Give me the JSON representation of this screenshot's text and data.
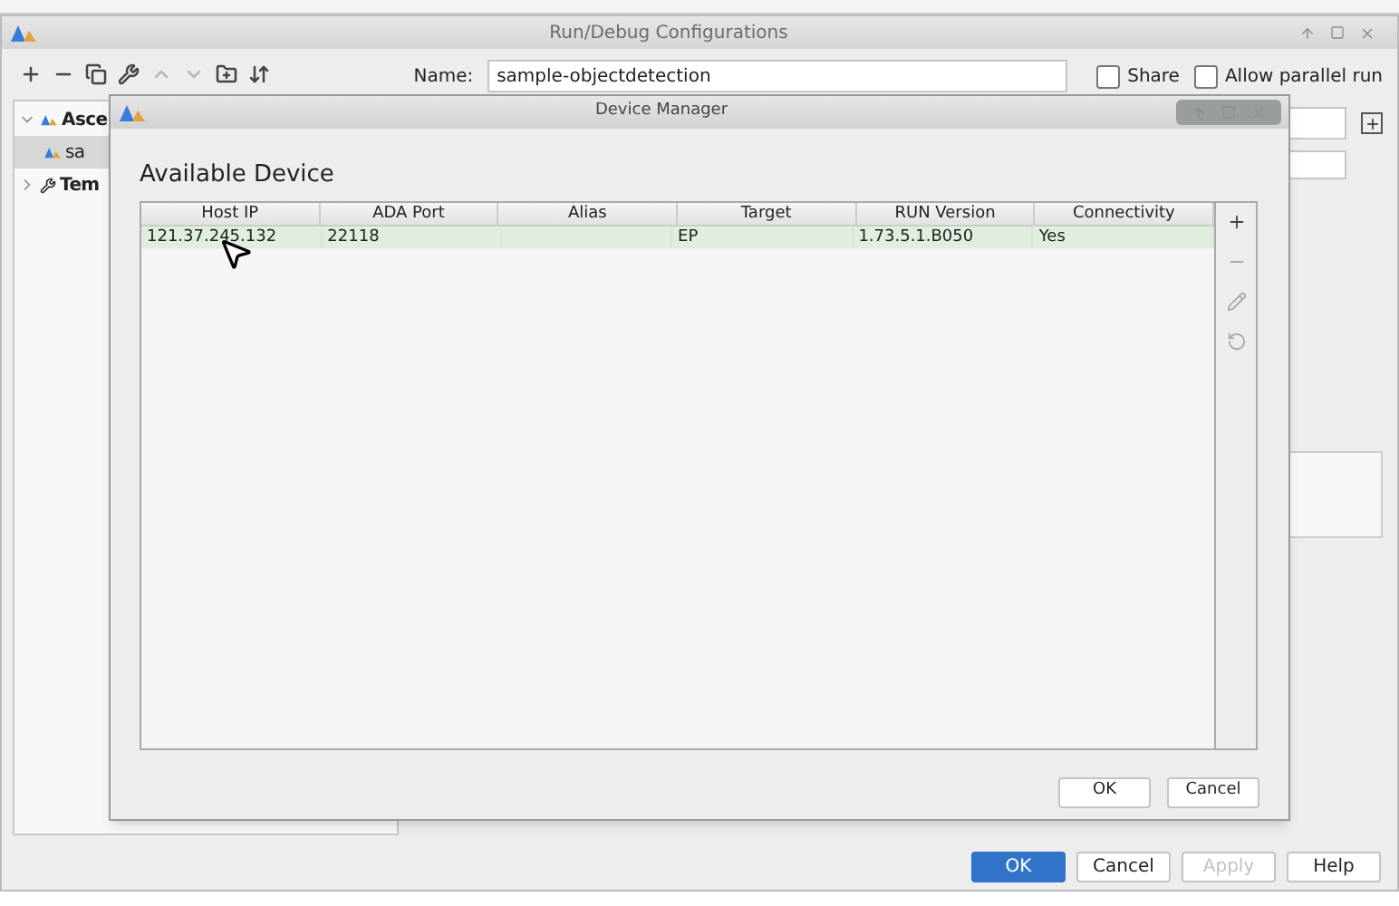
{
  "window": {
    "title": "Run/Debug Configurations"
  },
  "toolbar": [
    {
      "kind": "plus",
      "disabled": false
    },
    {
      "kind": "minus",
      "disabled": false
    },
    {
      "kind": "copy",
      "disabled": false
    },
    {
      "kind": "wrench",
      "disabled": false
    },
    {
      "kind": "up",
      "disabled": true
    },
    {
      "kind": "down",
      "disabled": true
    },
    {
      "kind": "folder",
      "disabled": false
    },
    {
      "kind": "sort",
      "disabled": false
    }
  ],
  "tree": [
    {
      "label": "Asce",
      "expanded": true,
      "selected": false,
      "kind": "app",
      "children": [
        {
          "label": "sa",
          "selected": true,
          "kind": "app"
        }
      ]
    },
    {
      "label": "Tem",
      "expanded": false,
      "selected": false,
      "kind": "wrench"
    }
  ],
  "name_field": {
    "label": "Name:",
    "value": "sample-objectdetection"
  },
  "options": [
    {
      "label": "Share",
      "checked": false
    },
    {
      "label": "Allow parallel run",
      "checked": false
    }
  ],
  "buttons": [
    {
      "label": "OK",
      "primary": true,
      "disabled": false
    },
    {
      "label": "Cancel",
      "primary": false,
      "disabled": false
    },
    {
      "label": "Apply",
      "primary": false,
      "disabled": true
    },
    {
      "label": "Help",
      "primary": false,
      "disabled": false
    }
  ],
  "dialog": {
    "title": "Device Manager",
    "heading": "Available Device",
    "columns": [
      "Host IP",
      "ADA Port",
      "Alias",
      "Target",
      "RUN Version",
      "Connectivity"
    ],
    "rows": [
      {
        "cells": [
          "121.37.245.132",
          "22118",
          "",
          "EP",
          "1.73.5.1.B050",
          "Yes"
        ],
        "selected": true
      }
    ],
    "side_tools": [
      {
        "kind": "plus",
        "disabled": false
      },
      {
        "kind": "minus",
        "disabled": true
      },
      {
        "kind": "edit",
        "disabled": true
      },
      {
        "kind": "refresh",
        "disabled": true
      }
    ],
    "buttons": [
      "OK",
      "Cancel"
    ]
  }
}
